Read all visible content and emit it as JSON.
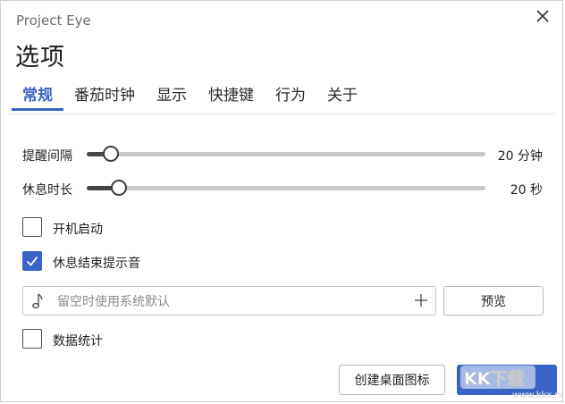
{
  "window": {
    "app_title": "Project Eye",
    "page_title": "选项"
  },
  "tabs": [
    {
      "label": "常规",
      "active": true
    },
    {
      "label": "番茄时钟",
      "active": false
    },
    {
      "label": "显示",
      "active": false
    },
    {
      "label": "快捷键",
      "active": false
    },
    {
      "label": "行为",
      "active": false
    },
    {
      "label": "关于",
      "active": false
    }
  ],
  "settings": {
    "reminder_interval": {
      "label": "提醒间隔",
      "value_text": "20 分钟",
      "fraction": 0.06
    },
    "rest_duration": {
      "label": "休息时长",
      "value_text": "20 秒",
      "fraction": 0.08
    },
    "startup": {
      "label": "开机启动",
      "checked": false
    },
    "rest_end_sound": {
      "label": "休息结束提示音",
      "checked": true
    },
    "sound_file": {
      "value": "",
      "placeholder": "留空时使用系统默认"
    },
    "preview_label": "预览",
    "statistics": {
      "label": "数据统计",
      "checked": false
    }
  },
  "footer": {
    "create_shortcut_label": "创建桌面图标",
    "primary_label": ""
  },
  "watermark": {
    "text": "KK下载",
    "url": "www.kkx.net"
  },
  "colors": {
    "accent": "#3a63c8",
    "track": "#c8c8c8",
    "fill": "#454545"
  },
  "icons": {
    "close": "close-icon",
    "note": "music-note-icon",
    "add": "plus-icon",
    "check": "check-icon"
  }
}
